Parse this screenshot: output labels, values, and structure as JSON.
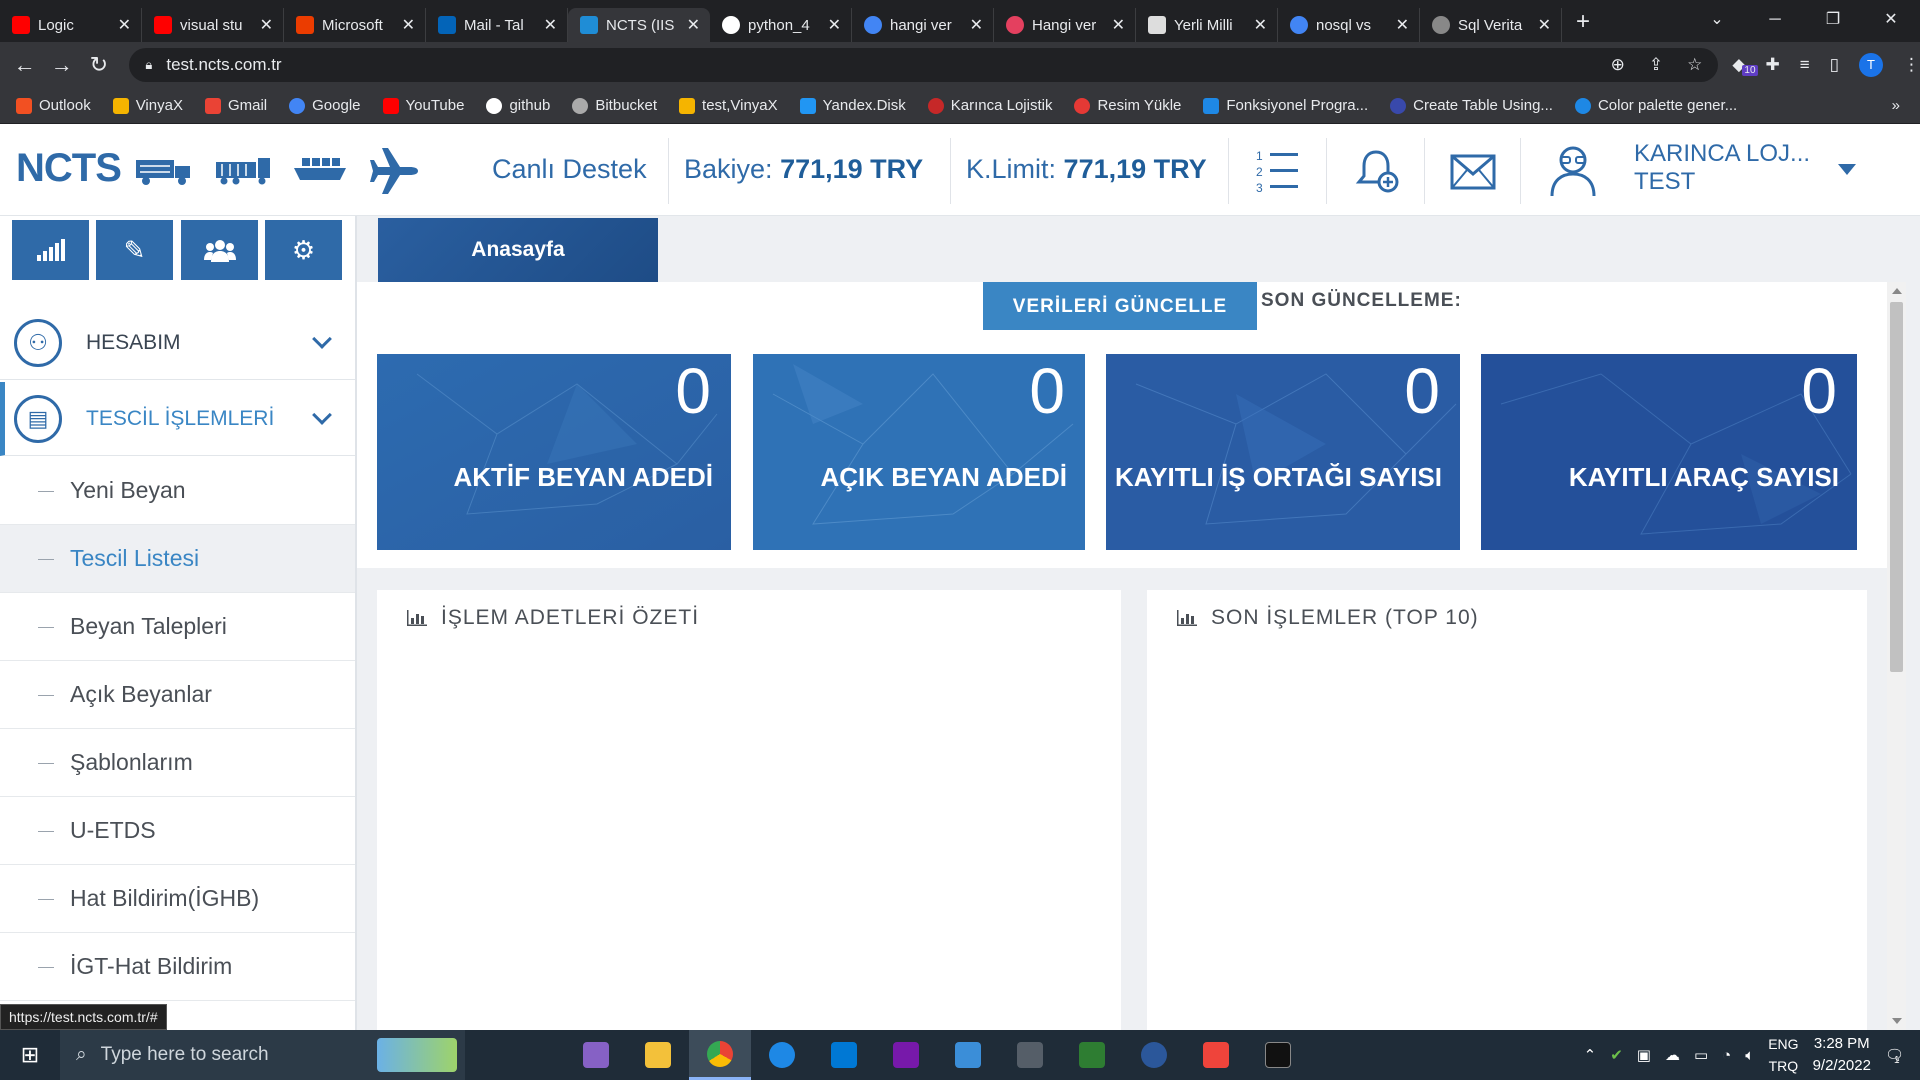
{
  "browser": {
    "tabs": [
      {
        "title": "Logic",
        "color": "#ff0000"
      },
      {
        "title": "visual stu",
        "color": "#ff0000"
      },
      {
        "title": "Microsoft",
        "color": "#eb3c00"
      },
      {
        "title": "Mail - Tal",
        "color": "#0364b8"
      },
      {
        "title": "NCTS (IIS",
        "color": "#1f8dd6"
      },
      {
        "title": "python_4",
        "color": "#ffffff"
      },
      {
        "title": "hangi ver",
        "color": "#4285f4"
      },
      {
        "title": "Hangi ver",
        "color": "#e4405f"
      },
      {
        "title": "Yerli Milli",
        "color": "#dddddd"
      },
      {
        "title": "nosql vs",
        "color": "#4285f4"
      },
      {
        "title": "Sql Verita",
        "color": "#888888"
      }
    ],
    "active_tab": 4,
    "url": "test.ncts.com.tr",
    "profile_initial": "T",
    "extension_badge": "10",
    "bookmarks": [
      {
        "label": "Outlook",
        "color": "#f25022"
      },
      {
        "label": "VinyaX",
        "color": "#f5b400"
      },
      {
        "label": "Gmail",
        "color": "#ea4335"
      },
      {
        "label": "Google",
        "color": "#4285f4"
      },
      {
        "label": "YouTube",
        "color": "#ff0000"
      },
      {
        "label": "github",
        "color": "#ffffff"
      },
      {
        "label": "Bitbucket",
        "color": "#aaaaaa"
      },
      {
        "label": "test,VinyaX",
        "color": "#f5b400"
      },
      {
        "label": "Yandex.Disk",
        "color": "#2196f3"
      },
      {
        "label": "Karınca Lojistik",
        "color": "#c62828"
      },
      {
        "label": "Resim Yükle",
        "color": "#e53935"
      },
      {
        "label": "Fonksiyonel Progra...",
        "color": "#1e88e5"
      },
      {
        "label": "Create Table Using...",
        "color": "#3949ab"
      },
      {
        "label": "Color palette gener...",
        "color": "#1e88e5"
      }
    ],
    "status_url": "https://test.ncts.com.tr/#"
  },
  "header": {
    "logo": "NCTS",
    "live_support": "Canlı Destek",
    "balance_label": "Bakiye:",
    "balance_value": "771,19 TRY",
    "limit_label": "K.Limit:",
    "limit_value": "771,19 TRY",
    "user_line1": "KARINCA LOJ...",
    "user_line2": "TEST"
  },
  "sidebar": {
    "groups": [
      {
        "label": "HESABIM"
      },
      {
        "label": "TESCİL İŞLEMLERİ"
      }
    ],
    "items": [
      {
        "label": "Yeni Beyan"
      },
      {
        "label": "Tescil Listesi"
      },
      {
        "label": "Beyan Talepleri"
      },
      {
        "label": "Açık Beyanlar"
      },
      {
        "label": "Şablonlarım"
      },
      {
        "label": "U-ETDS"
      },
      {
        "label": "Hat Bildirim(İGHB)"
      },
      {
        "label": "İGT-Hat Bildirim"
      }
    ],
    "selected_item": 1
  },
  "main": {
    "breadcrumb": "Anasayfa",
    "refresh_button": "VERİLERİ GÜNCELLE",
    "last_update_label": "SON GÜNCELLEME:",
    "stats": [
      {
        "value": "0",
        "label": "AKTİF BEYAN ADEDİ"
      },
      {
        "value": "0",
        "label": "AÇIK BEYAN ADEDİ"
      },
      {
        "value": "0",
        "label": "KAYITLI İŞ ORTAĞI SAYISI"
      },
      {
        "value": "0",
        "label": "KAYITLI ARAÇ SAYISI"
      }
    ],
    "panels": [
      {
        "title": "İŞLEM ADETLERİ ÖZETİ"
      },
      {
        "title": "SON İŞLEMLER (TOP 10)"
      }
    ]
  },
  "taskbar": {
    "search_placeholder": "Type here to search",
    "lang_line1": "ENG",
    "lang_line2": "TRQ",
    "time": "3:28 PM",
    "date": "9/2/2022",
    "notification_count": "1"
  },
  "colors": {
    "brand": "#2f6aa8",
    "accent": "#3a86c4"
  }
}
